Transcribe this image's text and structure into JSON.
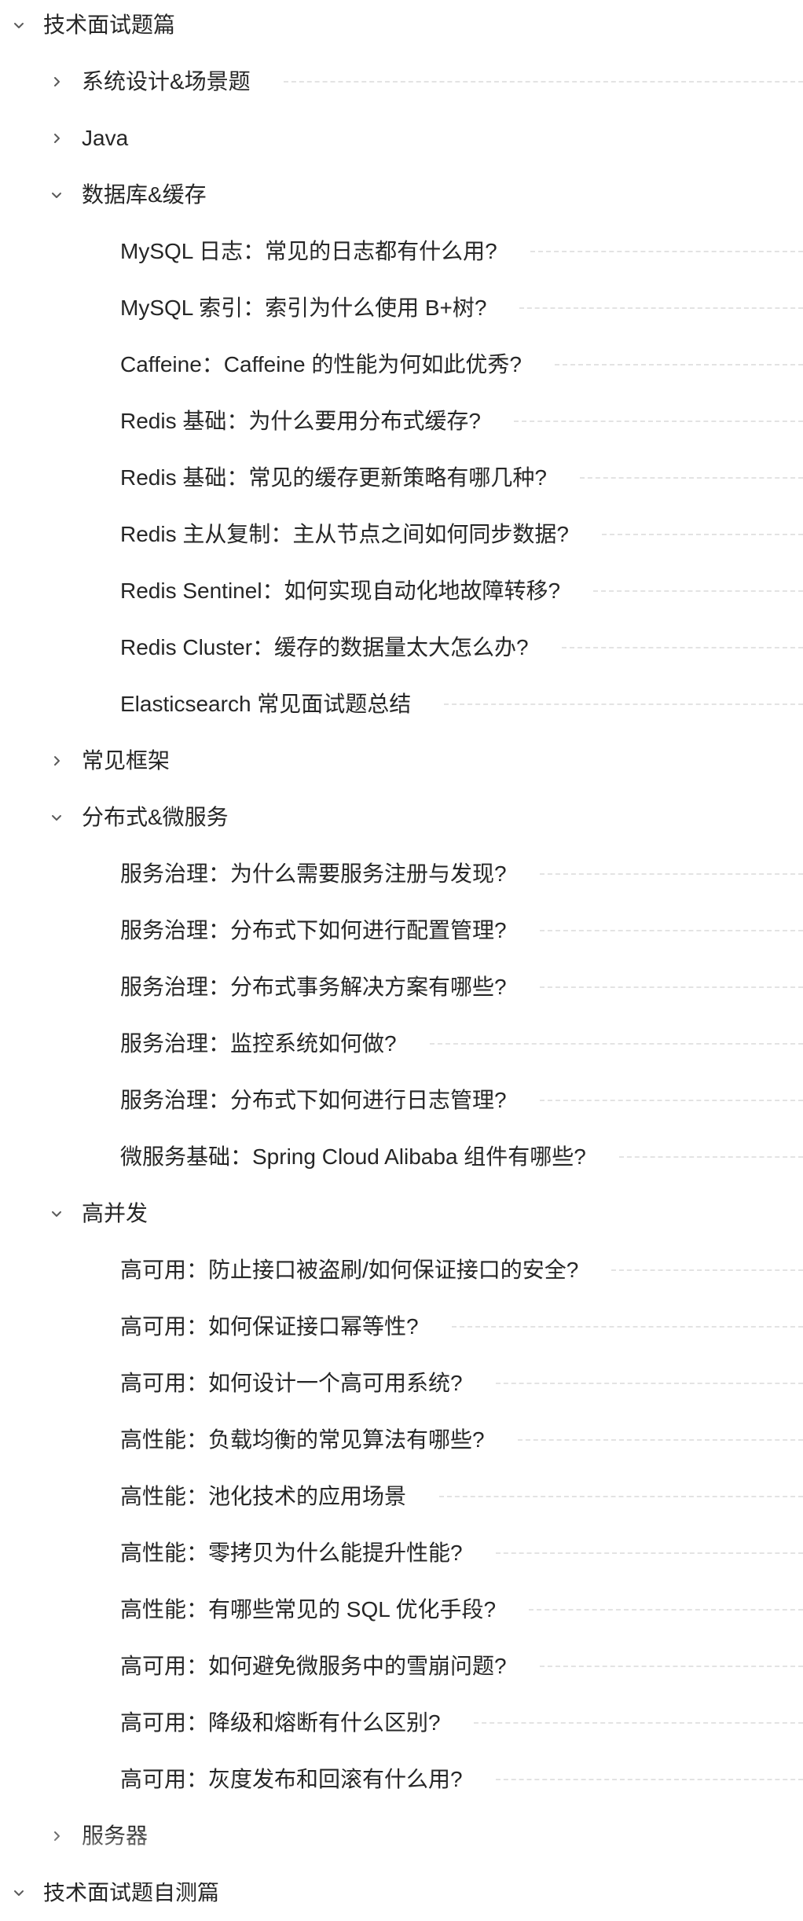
{
  "tree": [
    {
      "level": 0,
      "label": "技术面试题篇",
      "chevron": "chevron-down-icon",
      "leader": false
    },
    {
      "level": 1,
      "label": "系统设计&场景题",
      "chevron": "chevron-right-icon",
      "leader": true
    },
    {
      "level": 1,
      "label": "Java",
      "chevron": "chevron-right-icon",
      "leader": false
    },
    {
      "level": 1,
      "label": "数据库&缓存",
      "chevron": "chevron-down-icon",
      "leader": false
    },
    {
      "level": 2,
      "label": "MySQL 日志：常见的日志都有什么用?",
      "leader": true
    },
    {
      "level": 2,
      "label": "MySQL 索引：索引为什么使用 B+树?",
      "leader": true
    },
    {
      "level": 2,
      "label": "Caffeine：Caffeine 的性能为何如此优秀?",
      "leader": true
    },
    {
      "level": 2,
      "label": "Redis 基础：为什么要用分布式缓存?",
      "leader": true
    },
    {
      "level": 2,
      "label": "Redis 基础：常见的缓存更新策略有哪几种?",
      "leader": true
    },
    {
      "level": 2,
      "label": "Redis 主从复制：主从节点之间如何同步数据?",
      "leader": true
    },
    {
      "level": 2,
      "label": "Redis Sentinel：如何实现自动化地故障转移?",
      "leader": true
    },
    {
      "level": 2,
      "label": "Redis Cluster：缓存的数据量太大怎么办?",
      "leader": true
    },
    {
      "level": 2,
      "label": "Elasticsearch 常见面试题总结",
      "leader": true
    },
    {
      "level": 1,
      "label": "常见框架",
      "chevron": "chevron-right-icon",
      "leader": false
    },
    {
      "level": 1,
      "label": "分布式&微服务",
      "chevron": "chevron-down-icon",
      "leader": false
    },
    {
      "level": 2,
      "label": "服务治理：为什么需要服务注册与发现?",
      "leader": true
    },
    {
      "level": 2,
      "label": "服务治理：分布式下如何进行配置管理?",
      "leader": true
    },
    {
      "level": 2,
      "label": "服务治理：分布式事务解决方案有哪些?",
      "leader": true
    },
    {
      "level": 2,
      "label": "服务治理：监控系统如何做?",
      "leader": true
    },
    {
      "level": 2,
      "label": "服务治理：分布式下如何进行日志管理?",
      "leader": true
    },
    {
      "level": 2,
      "label": "微服务基础：Spring Cloud Alibaba 组件有哪些?",
      "leader": true
    },
    {
      "level": 1,
      "label": "高并发",
      "chevron": "chevron-down-icon",
      "leader": false
    },
    {
      "level": 2,
      "label": "高可用：防止接口被盗刷/如何保证接口的安全?",
      "leader": true
    },
    {
      "level": 2,
      "label": "高可用：如何保证接口幂等性?",
      "leader": true
    },
    {
      "level": 2,
      "label": "高可用：如何设计一个高可用系统?",
      "leader": true
    },
    {
      "level": 2,
      "label": "高性能：负载均衡的常见算法有哪些?",
      "leader": true
    },
    {
      "level": 2,
      "label": "高性能：池化技术的应用场景",
      "leader": true
    },
    {
      "level": 2,
      "label": "高性能：零拷贝为什么能提升性能?",
      "leader": true
    },
    {
      "level": 2,
      "label": "高性能：有哪些常见的 SQL 优化手段?",
      "leader": true
    },
    {
      "level": 2,
      "label": "高可用：如何避免微服务中的雪崩问题?",
      "leader": true
    },
    {
      "level": 2,
      "label": "高可用：降级和熔断有什么区别?",
      "leader": true
    },
    {
      "level": 2,
      "label": "高可用：灰度发布和回滚有什么用?",
      "leader": true
    },
    {
      "level": 1,
      "label": "服务器",
      "chevron": "chevron-right-icon",
      "leader": false
    },
    {
      "level": 0,
      "label": "技术面试题自测篇",
      "chevron": "chevron-down-icon",
      "leader": false
    }
  ]
}
